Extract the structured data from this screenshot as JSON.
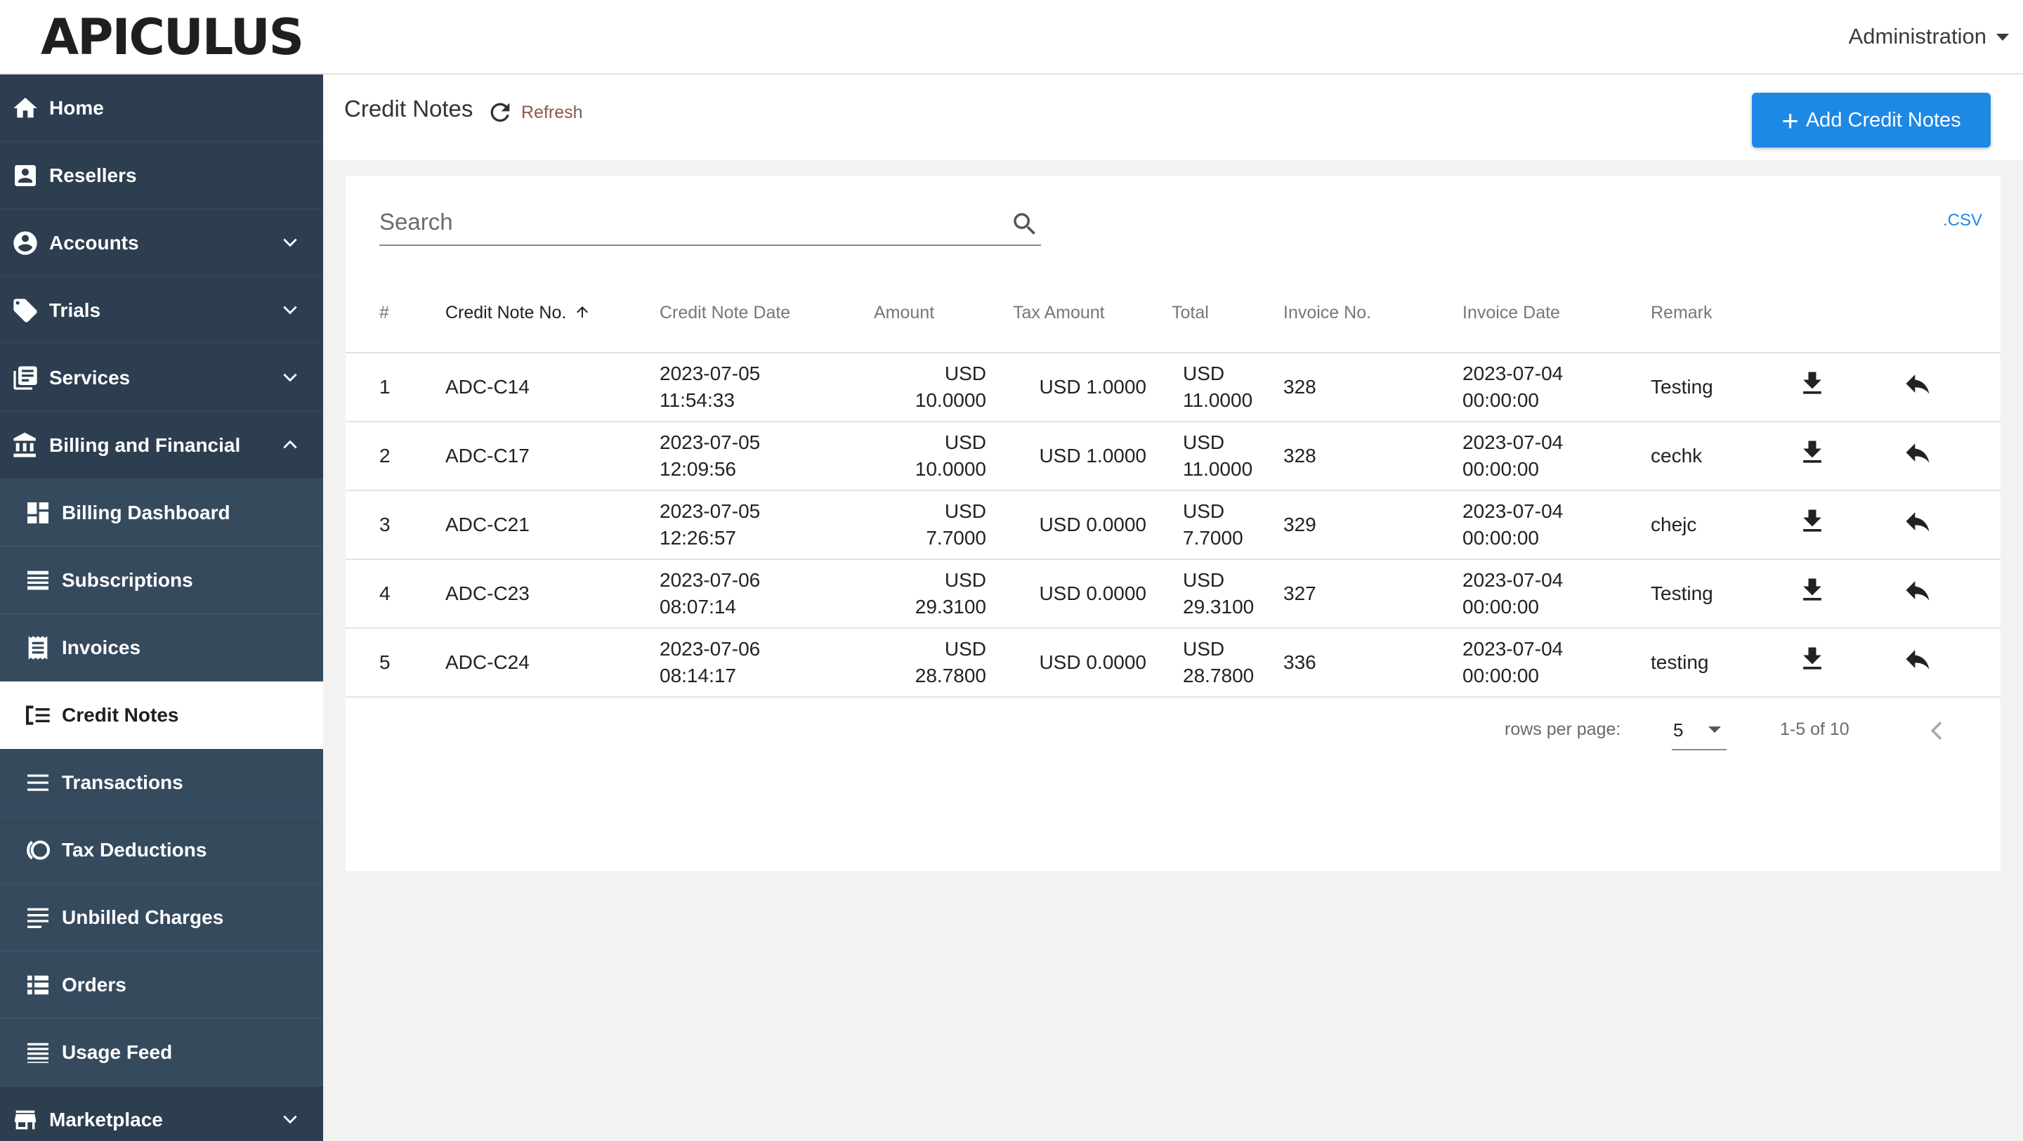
{
  "app": {
    "logo_text": "APICULUS",
    "admin_menu_label": "Administration"
  },
  "sidebar": {
    "items": [
      {
        "label": "Home",
        "icon": "home-icon"
      },
      {
        "label": "Resellers",
        "icon": "contact-icon"
      },
      {
        "label": "Accounts",
        "icon": "account-circle-icon",
        "expandable": true
      },
      {
        "label": "Trials",
        "icon": "tag-icon",
        "expandable": true
      },
      {
        "label": "Services",
        "icon": "library-icon",
        "expandable": true
      },
      {
        "label": "Billing and Financial",
        "icon": "bank-icon",
        "expandable": true,
        "expanded": true
      },
      {
        "label": "Billing Dashboard",
        "icon": "dashboard-icon",
        "sub": true
      },
      {
        "label": "Subscriptions",
        "icon": "list-icon",
        "sub": true
      },
      {
        "label": "Invoices",
        "icon": "receipt-icon",
        "sub": true
      },
      {
        "label": "Credit Notes",
        "icon": "credit-note-icon",
        "sub": true,
        "active": true
      },
      {
        "label": "Transactions",
        "icon": "menu-icon",
        "sub": true
      },
      {
        "label": "Tax Deductions",
        "icon": "tax-icon",
        "sub": true
      },
      {
        "label": "Unbilled Charges",
        "icon": "notes-icon",
        "sub": true
      },
      {
        "label": "Orders",
        "icon": "orders-list-icon",
        "sub": true
      },
      {
        "label": "Usage Feed",
        "icon": "feed-icon",
        "sub": true
      },
      {
        "label": "Marketplace",
        "icon": "store-icon",
        "expandable": true
      }
    ]
  },
  "header": {
    "title": "Credit Notes",
    "refresh_label": "Refresh",
    "add_button_label": "Add Credit Notes"
  },
  "search": {
    "placeholder": "Search",
    "value": ""
  },
  "csv_label": ".CSV",
  "table": {
    "columns": [
      "#",
      "Credit Note No.",
      "Credit Note Date",
      "Amount",
      "Tax Amount",
      "Total",
      "Invoice No.",
      "Invoice Date",
      "Remark"
    ],
    "sorted_column": "Credit Note No.",
    "rows": [
      {
        "num": "1",
        "credit_note_no": "ADC-C14",
        "date": "2023-07-05",
        "time": "11:54:33",
        "amount_cur": "USD",
        "amount_val": "10.0000",
        "tax": "USD 1.0000",
        "total_cur": "USD",
        "total_val": "11.0000",
        "invoice_no": "328",
        "invoice_date": "2023-07-04",
        "invoice_time": "00:00:00",
        "remark": "Testing"
      },
      {
        "num": "2",
        "credit_note_no": "ADC-C17",
        "date": "2023-07-05",
        "time": "12:09:56",
        "amount_cur": "USD",
        "amount_val": "10.0000",
        "tax": "USD 1.0000",
        "total_cur": "USD",
        "total_val": "11.0000",
        "invoice_no": "328",
        "invoice_date": "2023-07-04",
        "invoice_time": "00:00:00",
        "remark": "cechk"
      },
      {
        "num": "3",
        "credit_note_no": "ADC-C21",
        "date": "2023-07-05",
        "time": "12:26:57",
        "amount_cur": "USD",
        "amount_val": "7.7000",
        "tax": "USD 0.0000",
        "total_cur": "USD",
        "total_val": "7.7000",
        "invoice_no": "329",
        "invoice_date": "2023-07-04",
        "invoice_time": "00:00:00",
        "remark": "chejc"
      },
      {
        "num": "4",
        "credit_note_no": "ADC-C23",
        "date": "2023-07-06",
        "time": "08:07:14",
        "amount_cur": "USD",
        "amount_val": "29.3100",
        "tax": "USD 0.0000",
        "total_cur": "USD",
        "total_val": "29.3100",
        "invoice_no": "327",
        "invoice_date": "2023-07-04",
        "invoice_time": "00:00:00",
        "remark": "Testing"
      },
      {
        "num": "5",
        "credit_note_no": "ADC-C24",
        "date": "2023-07-06",
        "time": "08:14:17",
        "amount_cur": "USD",
        "amount_val": "28.7800",
        "tax": "USD 0.0000",
        "total_cur": "USD",
        "total_val": "28.7800",
        "invoice_no": "336",
        "invoice_date": "2023-07-04",
        "invoice_time": "00:00:00",
        "remark": "testing"
      }
    ],
    "row_actions": [
      "download-icon",
      "reply-icon"
    ]
  },
  "pagination": {
    "rows_per_page_label": "rows per page:",
    "rows_per_page_value": "5",
    "range_text": "1-5 of 10"
  },
  "colors": {
    "sidebar_bg": "#2c3e50",
    "sidebar_sub_bg": "#364a5e",
    "accent": "#1e88e5",
    "refresh_text": "#8a5a45"
  }
}
